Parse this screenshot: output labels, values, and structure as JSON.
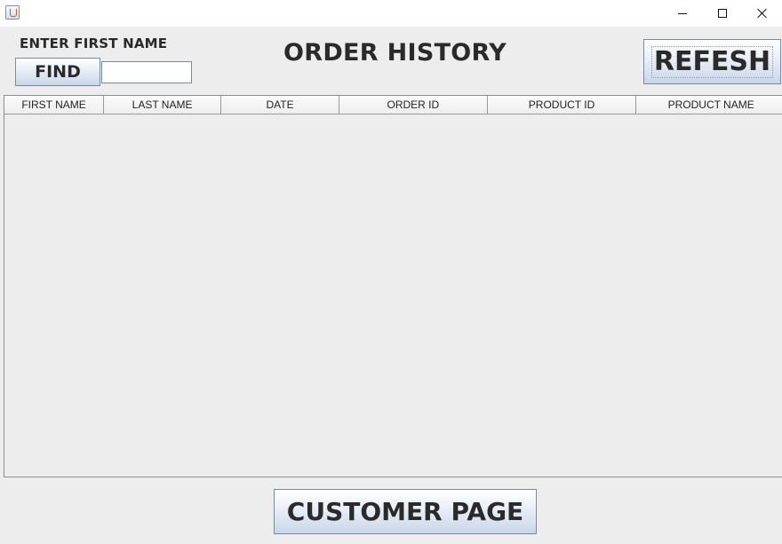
{
  "window": {
    "title": "",
    "controls": {
      "minimize": "minimize-icon",
      "maximize": "maximize-icon",
      "close": "close-icon"
    }
  },
  "search": {
    "label": "ENTER FIRST NAME",
    "find_label": "FIND",
    "value": "",
    "placeholder": ""
  },
  "header": {
    "title": "ORDER HISTORY",
    "refresh_label": "REFESH"
  },
  "table": {
    "columns": [
      "FIRST NAME",
      "LAST NAME",
      "DATE",
      "ORDER ID",
      "PRODUCT ID",
      "PRODUCT NAME"
    ],
    "rows": []
  },
  "footer": {
    "customer_page_label": "CUSTOMER PAGE"
  }
}
